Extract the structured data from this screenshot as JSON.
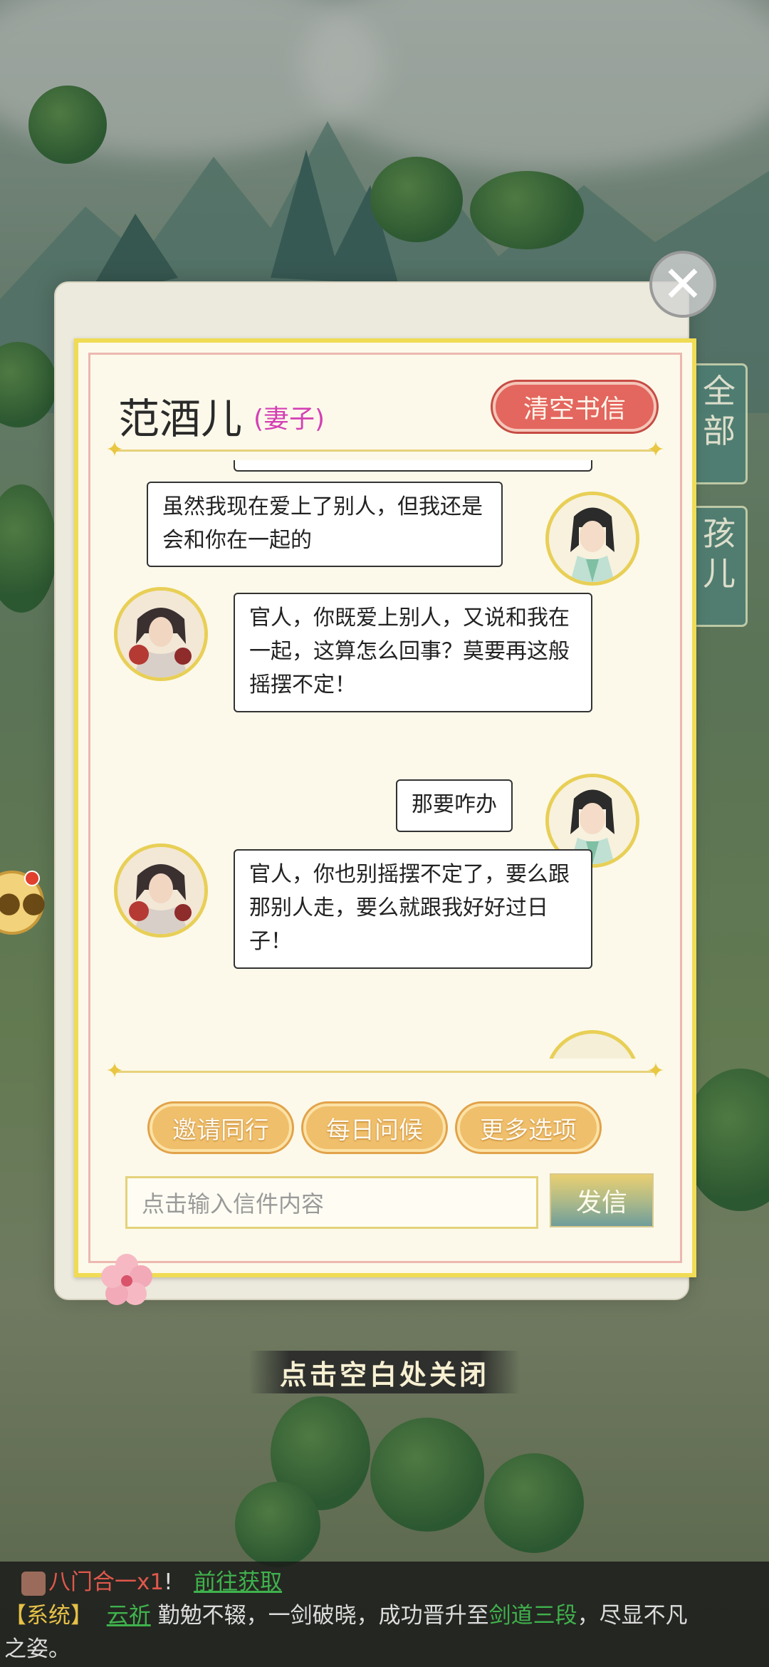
{
  "popup": {
    "name": "范酒儿",
    "role": "(妻子)",
    "clear_button": "清空书信",
    "close_hint": "点击空白处关闭"
  },
  "side_tabs": [
    {
      "label": "全部"
    },
    {
      "label": "孩儿"
    }
  ],
  "messages": [
    {
      "sender": "player",
      "text": "虽然我现在爱上了别人，但我还是会和你在一起的"
    },
    {
      "sender": "wife",
      "text": "官人，你既爱上别人，又说和我在一起，这算怎么回事？莫要再这般摇摆不定！"
    },
    {
      "sender": "player",
      "text": "那要咋办"
    },
    {
      "sender": "wife",
      "text": "官人，你也别摇摆不定了，要么跟那别人走，要么就跟我好好过日子！"
    }
  ],
  "actions": {
    "invite": "邀请同行",
    "daily": "每日问候",
    "more": "更多选项"
  },
  "input": {
    "placeholder": "点击输入信件内容",
    "send_label": "发信"
  },
  "system_bar": {
    "item_text": "八门合一x1",
    "exclaim": "!",
    "get_link": "前往获取",
    "tag": "【系统】",
    "player": "云祈",
    "text1": "勤勉不辍，一剑破晓，成功晋升至",
    "rank": "剑道三段",
    "text2": "，尽显不凡",
    "text3": "之姿。"
  },
  "colors": {
    "letter_border": "#f0db54",
    "role_pink": "#d43fb4",
    "clear_red": "#e3665f",
    "action_orange": "#f0bf6b"
  }
}
